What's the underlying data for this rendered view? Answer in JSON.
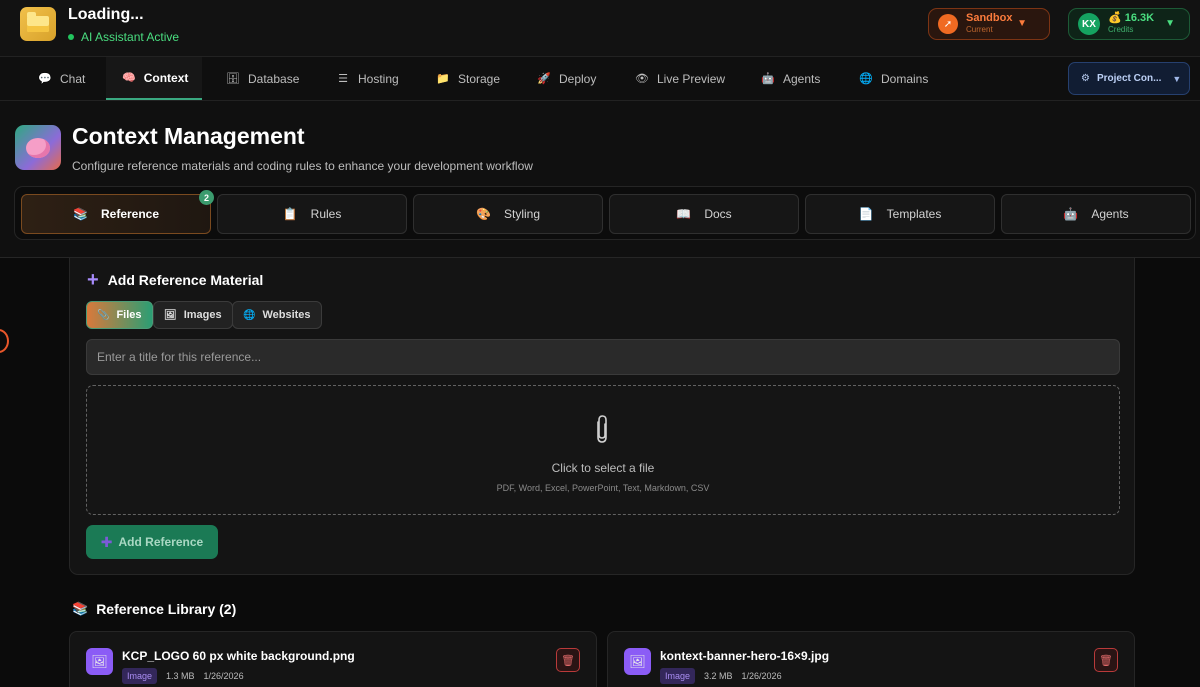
{
  "app": {
    "title": "Loading...",
    "status": "AI Assistant Active"
  },
  "environment": {
    "name": "Sandbox",
    "sub": "Current"
  },
  "credits": {
    "initials": "KX",
    "amount": "16.3K",
    "sub": "Credits"
  },
  "nav": {
    "tabs": [
      {
        "label": "Chat",
        "icon": "chat-bubble-icon"
      },
      {
        "label": "Context",
        "icon": "brain-icon"
      },
      {
        "label": "Database",
        "icon": "database-icon"
      },
      {
        "label": "Hosting",
        "icon": "server-icon"
      },
      {
        "label": "Storage",
        "icon": "folder-icon"
      },
      {
        "label": "Deploy",
        "icon": "rocket-icon"
      },
      {
        "label": "Live Preview",
        "icon": "eye-icon"
      },
      {
        "label": "Agents",
        "icon": "robot-icon"
      },
      {
        "label": "Domains",
        "icon": "globe-icon"
      }
    ],
    "active": "Context",
    "project_button": "Project Con..."
  },
  "header": {
    "title": "Context Management",
    "subtitle": "Configure reference materials and coding rules to enhance your development workflow"
  },
  "subtabs": {
    "items": [
      {
        "label": "Reference",
        "icon": "books-icon",
        "badge": "2"
      },
      {
        "label": "Rules",
        "icon": "clipboard-icon"
      },
      {
        "label": "Styling",
        "icon": "palette-icon"
      },
      {
        "label": "Docs",
        "icon": "open-book-icon"
      },
      {
        "label": "Templates",
        "icon": "page-icon"
      },
      {
        "label": "Agents",
        "icon": "robot-icon"
      }
    ],
    "active": "Reference"
  },
  "add_reference": {
    "title": "Add Reference Material",
    "types": [
      {
        "label": "Files",
        "icon": "paperclip-icon"
      },
      {
        "label": "Images",
        "icon": "picture-icon"
      },
      {
        "label": "Websites",
        "icon": "globe-icon"
      }
    ],
    "active_type": "Files",
    "title_placeholder": "Enter a title for this reference...",
    "drop_main": "Click to select a file",
    "drop_sub": "PDF, Word, Excel, PowerPoint, Text, Markdown, CSV",
    "add_button": "Add Reference"
  },
  "library": {
    "title": "Reference Library (2)",
    "items": [
      {
        "name": "KCP_LOGO 60 px white background.png",
        "tag": "Image",
        "size": "1.3 MB",
        "date": "1/26/2026"
      },
      {
        "name": "kontext-banner-hero-16×9.jpg",
        "tag": "Image",
        "size": "3.2 MB",
        "date": "1/26/2026"
      }
    ]
  },
  "colors": {
    "accent_green": "#3aa981",
    "sandbox_orange": "#fb7b3c",
    "credits_green": "#4ade80",
    "danger_red": "#b93a3a",
    "tag_purple": "#8b5cf6"
  }
}
